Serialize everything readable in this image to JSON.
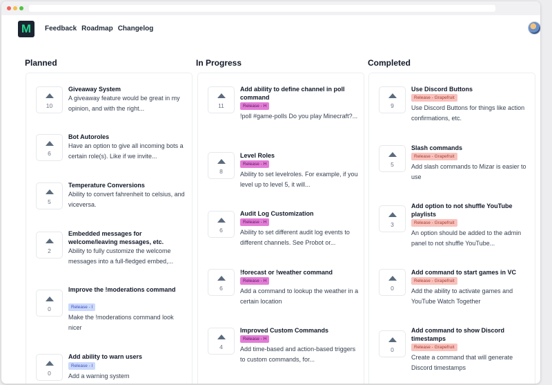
{
  "nav": {
    "logo": "M",
    "links": [
      "Feedback",
      "Roadmap",
      "Changelog"
    ]
  },
  "columns": [
    {
      "title": "Planned",
      "cards": [
        {
          "votes": "10",
          "title": "Giveaway System",
          "badge": "",
          "description": "A giveaway feature would be great in my opinion, and with the right..."
        },
        {
          "votes": "6",
          "title": "Bot Autoroles",
          "badge": "",
          "description": "Have an option to give all incoming bots a certain role(s). Like if we invite..."
        },
        {
          "votes": "5",
          "title": "Temperature Conversions",
          "badge": "",
          "description": "Ability to convert fahrenheit to celsius, and viceversa."
        },
        {
          "votes": "2",
          "title": "Embedded messages for welcome/leaving messages, etc.",
          "badge": "",
          "description": "Ability to fully customize the welcome messages into a full-fledged embed,..."
        },
        {
          "votes": "0",
          "title": "Improve the !moderations command",
          "badge": "Release - I",
          "description": "Make the !moderations command look nicer"
        },
        {
          "votes": "0",
          "title": "Add ability to warn users",
          "badge": "Release - I",
          "description": "Add a warning system"
        }
      ]
    },
    {
      "title": "In Progress",
      "cards": [
        {
          "votes": "11",
          "title": "Add ability to define channel in poll command",
          "badge": "Release - H",
          "description": "!poll #game-polls Do you play Minecraft?..."
        },
        {
          "votes": "8",
          "title": "Level Roles",
          "badge": "Release - H",
          "description": "Ability to set levelroles. For example, if you level up to level 5, it will..."
        },
        {
          "votes": "6",
          "title": "Audit Log Customization",
          "badge": "Release - H",
          "description": "Ability to set different audit log events to different channels. See Probot or..."
        },
        {
          "votes": "6",
          "title": "!forecast or !weather command",
          "badge": "Release - H",
          "description": "Add a command to lookup the weather in a certain location"
        },
        {
          "votes": "4",
          "title": "Improved Custom Commands",
          "badge": "Release - H",
          "description": "Add time-based and action-based triggers to custom commands, for..."
        }
      ]
    },
    {
      "title": "Completed",
      "cards": [
        {
          "votes": "9",
          "title": "Use Discord Buttons",
          "badge": "Release - Grapefruit",
          "description": "Use Discord Buttons for things like action confirmations, etc."
        },
        {
          "votes": "5",
          "title": "Slash commands",
          "badge": "Release - Grapefruit",
          "description": "Add slash commands to Mizar is easier to use"
        },
        {
          "votes": "3",
          "title": "Add option to not shuffle YouTube playlists",
          "badge": "Release - Grapefruit",
          "description": "An option should be added to the admin panel to not shuffle YouTube..."
        },
        {
          "votes": "0",
          "title": "Add command to start games in VC",
          "badge": "Release - Grapefruit",
          "description": "Add the ability to activate games and YouTube Watch Together"
        },
        {
          "votes": "0",
          "title": "Add command to show Discord timestamps",
          "badge": "Release - Grapefruit",
          "description": "Create a command that will generate Discord timestamps"
        }
      ]
    }
  ],
  "colors": {
    "badge_i": "#cad8fb",
    "badge_h": "#e27dd6",
    "badge_grapefruit": "#f8c2bd",
    "logo_bg": "#1c2431",
    "logo_fg": "#25d18e"
  }
}
